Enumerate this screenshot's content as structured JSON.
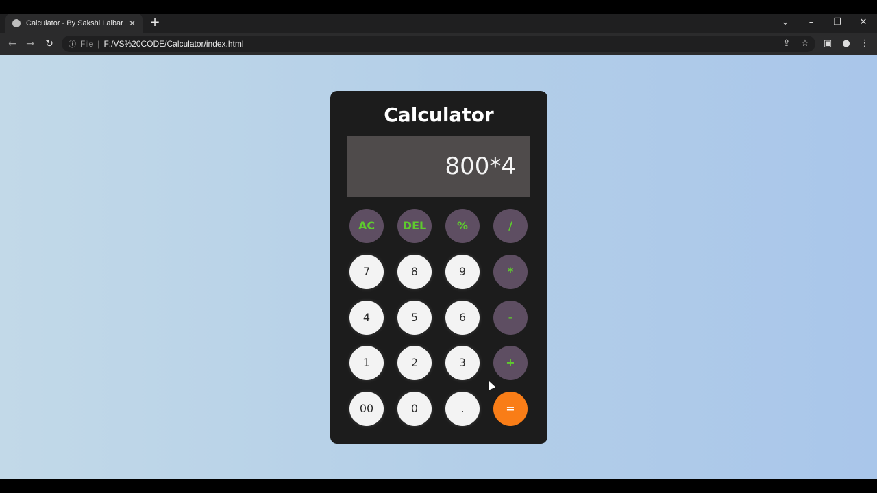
{
  "browser": {
    "tab_title": "Calculator - By Sakshi Laibar",
    "tab_close": "✕",
    "new_tab": "+",
    "address_scheme": "File",
    "address_url": "F:/VS%20CODE/Calculator/index.html"
  },
  "calculator": {
    "title": "Calculator",
    "display_value": "800*4",
    "keys": [
      [
        "AC",
        "DEL",
        "%",
        "/"
      ],
      [
        "7",
        "8",
        "9",
        "*"
      ],
      [
        "4",
        "5",
        "6",
        "-"
      ],
      [
        "1",
        "2",
        "3",
        "+"
      ],
      [
        "00",
        "0",
        ".",
        "="
      ]
    ]
  },
  "colors": {
    "operator_bg": "#5e4e62",
    "operator_text": "#5ecb2e",
    "equals_bg": "#f97d17",
    "number_bg": "#f3f3f3",
    "display_bg": "#4f4b4b",
    "panel_bg": "#1c1c1c"
  },
  "icons": [
    "globe-icon",
    "close-icon",
    "plus-icon",
    "back-icon",
    "forward-icon",
    "reload-icon",
    "info-icon",
    "share-icon",
    "star-icon",
    "sidebar-icon",
    "profile-icon",
    "menu-icon",
    "chevron-down-icon",
    "minimize-icon",
    "restore-icon",
    "window-close-icon"
  ]
}
